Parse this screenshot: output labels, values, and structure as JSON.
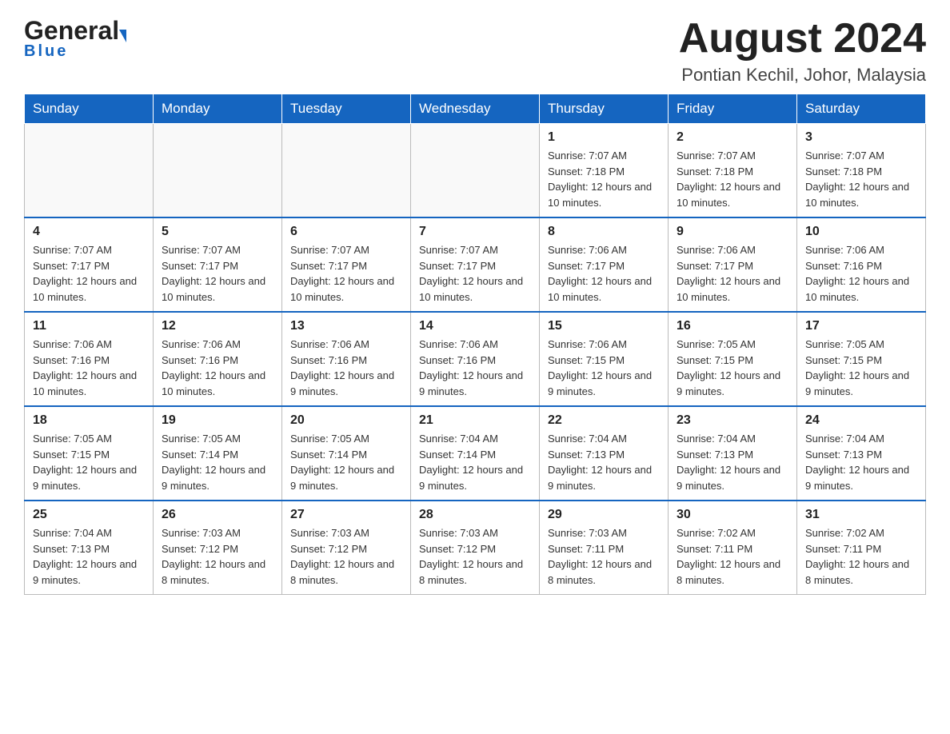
{
  "header": {
    "logo_general": "General",
    "logo_blue": "Blue",
    "title": "August 2024",
    "subtitle": "Pontian Kechil, Johor, Malaysia"
  },
  "calendar": {
    "days_of_week": [
      "Sunday",
      "Monday",
      "Tuesday",
      "Wednesday",
      "Thursday",
      "Friday",
      "Saturday"
    ],
    "weeks": [
      [
        {
          "day": "",
          "info": ""
        },
        {
          "day": "",
          "info": ""
        },
        {
          "day": "",
          "info": ""
        },
        {
          "day": "",
          "info": ""
        },
        {
          "day": "1",
          "info": "Sunrise: 7:07 AM\nSunset: 7:18 PM\nDaylight: 12 hours and 10 minutes."
        },
        {
          "day": "2",
          "info": "Sunrise: 7:07 AM\nSunset: 7:18 PM\nDaylight: 12 hours and 10 minutes."
        },
        {
          "day": "3",
          "info": "Sunrise: 7:07 AM\nSunset: 7:18 PM\nDaylight: 12 hours and 10 minutes."
        }
      ],
      [
        {
          "day": "4",
          "info": "Sunrise: 7:07 AM\nSunset: 7:17 PM\nDaylight: 12 hours and 10 minutes."
        },
        {
          "day": "5",
          "info": "Sunrise: 7:07 AM\nSunset: 7:17 PM\nDaylight: 12 hours and 10 minutes."
        },
        {
          "day": "6",
          "info": "Sunrise: 7:07 AM\nSunset: 7:17 PM\nDaylight: 12 hours and 10 minutes."
        },
        {
          "day": "7",
          "info": "Sunrise: 7:07 AM\nSunset: 7:17 PM\nDaylight: 12 hours and 10 minutes."
        },
        {
          "day": "8",
          "info": "Sunrise: 7:06 AM\nSunset: 7:17 PM\nDaylight: 12 hours and 10 minutes."
        },
        {
          "day": "9",
          "info": "Sunrise: 7:06 AM\nSunset: 7:17 PM\nDaylight: 12 hours and 10 minutes."
        },
        {
          "day": "10",
          "info": "Sunrise: 7:06 AM\nSunset: 7:16 PM\nDaylight: 12 hours and 10 minutes."
        }
      ],
      [
        {
          "day": "11",
          "info": "Sunrise: 7:06 AM\nSunset: 7:16 PM\nDaylight: 12 hours and 10 minutes."
        },
        {
          "day": "12",
          "info": "Sunrise: 7:06 AM\nSunset: 7:16 PM\nDaylight: 12 hours and 10 minutes."
        },
        {
          "day": "13",
          "info": "Sunrise: 7:06 AM\nSunset: 7:16 PM\nDaylight: 12 hours and 9 minutes."
        },
        {
          "day": "14",
          "info": "Sunrise: 7:06 AM\nSunset: 7:16 PM\nDaylight: 12 hours and 9 minutes."
        },
        {
          "day": "15",
          "info": "Sunrise: 7:06 AM\nSunset: 7:15 PM\nDaylight: 12 hours and 9 minutes."
        },
        {
          "day": "16",
          "info": "Sunrise: 7:05 AM\nSunset: 7:15 PM\nDaylight: 12 hours and 9 minutes."
        },
        {
          "day": "17",
          "info": "Sunrise: 7:05 AM\nSunset: 7:15 PM\nDaylight: 12 hours and 9 minutes."
        }
      ],
      [
        {
          "day": "18",
          "info": "Sunrise: 7:05 AM\nSunset: 7:15 PM\nDaylight: 12 hours and 9 minutes."
        },
        {
          "day": "19",
          "info": "Sunrise: 7:05 AM\nSunset: 7:14 PM\nDaylight: 12 hours and 9 minutes."
        },
        {
          "day": "20",
          "info": "Sunrise: 7:05 AM\nSunset: 7:14 PM\nDaylight: 12 hours and 9 minutes."
        },
        {
          "day": "21",
          "info": "Sunrise: 7:04 AM\nSunset: 7:14 PM\nDaylight: 12 hours and 9 minutes."
        },
        {
          "day": "22",
          "info": "Sunrise: 7:04 AM\nSunset: 7:13 PM\nDaylight: 12 hours and 9 minutes."
        },
        {
          "day": "23",
          "info": "Sunrise: 7:04 AM\nSunset: 7:13 PM\nDaylight: 12 hours and 9 minutes."
        },
        {
          "day": "24",
          "info": "Sunrise: 7:04 AM\nSunset: 7:13 PM\nDaylight: 12 hours and 9 minutes."
        }
      ],
      [
        {
          "day": "25",
          "info": "Sunrise: 7:04 AM\nSunset: 7:13 PM\nDaylight: 12 hours and 9 minutes."
        },
        {
          "day": "26",
          "info": "Sunrise: 7:03 AM\nSunset: 7:12 PM\nDaylight: 12 hours and 8 minutes."
        },
        {
          "day": "27",
          "info": "Sunrise: 7:03 AM\nSunset: 7:12 PM\nDaylight: 12 hours and 8 minutes."
        },
        {
          "day": "28",
          "info": "Sunrise: 7:03 AM\nSunset: 7:12 PM\nDaylight: 12 hours and 8 minutes."
        },
        {
          "day": "29",
          "info": "Sunrise: 7:03 AM\nSunset: 7:11 PM\nDaylight: 12 hours and 8 minutes."
        },
        {
          "day": "30",
          "info": "Sunrise: 7:02 AM\nSunset: 7:11 PM\nDaylight: 12 hours and 8 minutes."
        },
        {
          "day": "31",
          "info": "Sunrise: 7:02 AM\nSunset: 7:11 PM\nDaylight: 12 hours and 8 minutes."
        }
      ]
    ]
  }
}
